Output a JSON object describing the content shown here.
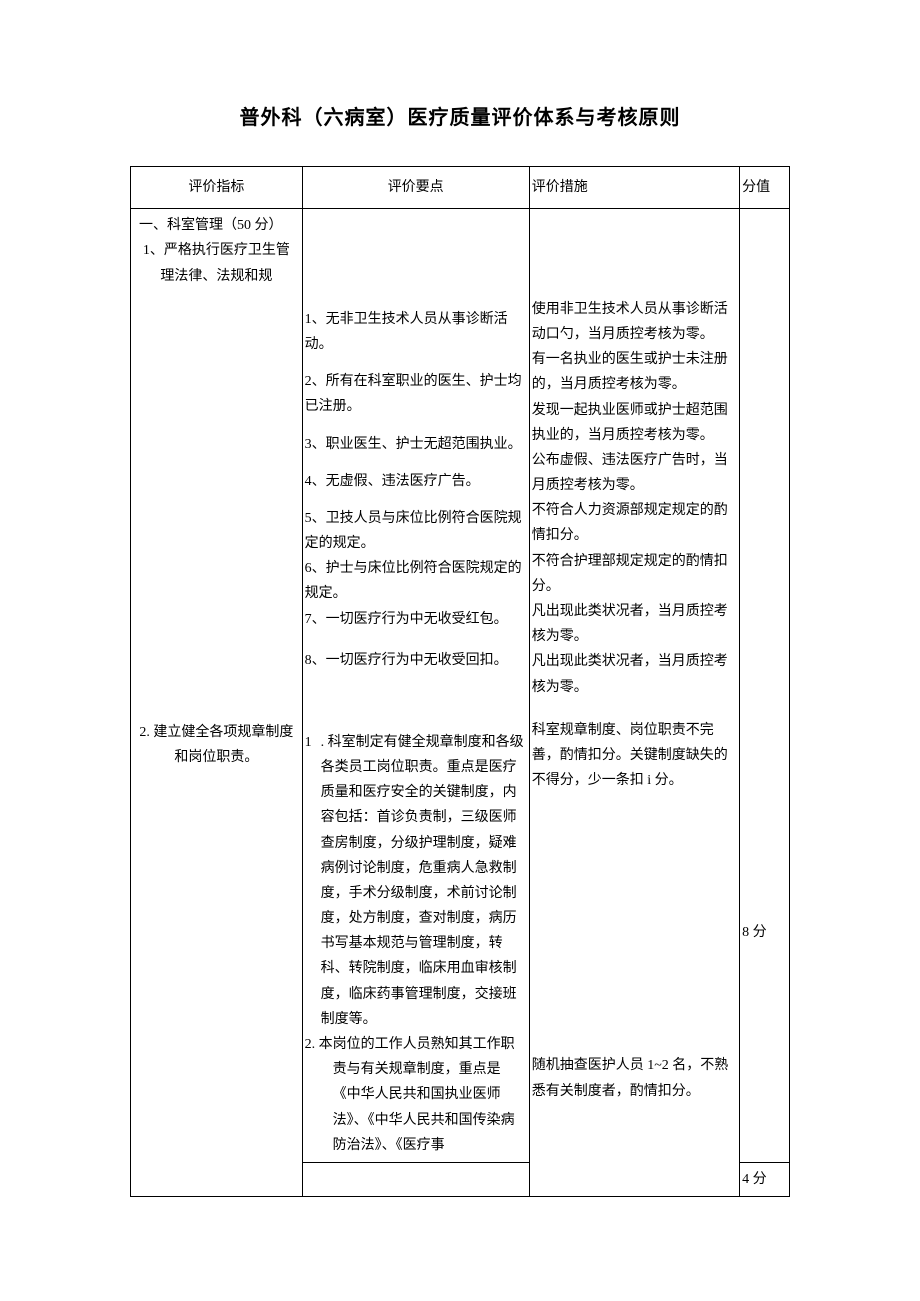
{
  "title": "普外科（六病室）医疗质量评价体系与考核原则",
  "headers": {
    "indicator": "评价指标",
    "points": "评价要点",
    "measures": "评价措施",
    "score": "分值"
  },
  "section1": {
    "heading": "一、科室管理（50 分）",
    "sub1": "1、严格执行医疗卫生管理法律、法规和规",
    "points": [
      "1、无非卫生技术人员从事诊断活动。",
      "2、所有在科室职业的医生、护士均已注册。",
      "3、职业医生、护士无超范围执业。",
      "4、无虚假、违法医疗广告。",
      "5、卫技人员与床位比例符合医院规定的规定。",
      "6、护士与床位比例符合医院规定的规定。",
      "7、一切医疗行为中无收受红包。",
      "8、一切医疗行为中无收受回扣。"
    ],
    "measures": [
      "使用非卫生技术人员从事诊断活动口勺，当月质控考核为零。",
      "有一名执业的医生或护士未注册的，当月质控考核为零。",
      "发现一起执业医师或护士超范围执业的，当月质控考核为零。",
      "公布虚假、违法医疗广告时，当月质控考核为零。",
      "不符合人力资源部规定规定的酌情扣分。",
      "不符合护理部规定规定的酌情扣分。",
      "凡出现此类状况者，当月质控考核为零。",
      "凡出现此类状况者，当月质控考核为零。"
    ]
  },
  "section2": {
    "heading": "2. 建立健全各项规章制度和岗位职责。",
    "point1_prefix": "1",
    "point1": ". 科室制定有健全规章制度和各级各类员工岗位职责。重点是医疗质量和医疗安全的关键制度，内容包括：首诊负责制，三级医师查房制度，分级护理制度，疑难病例讨论制度，危重病人急救制度，手术分级制度，术前讨论制度，处方制度，查对制度，病历书写基本规范与管理制度，转科、转院制度，临床用血审核制度，临床药事管理制度，交接班制度等。",
    "point2": "2. 本岗位的工作人员熟知其工作职责与有关规章制度，重点是《中华人民共和国执业医师法》、《中华人民共和国传染病防治法》、《医疗事",
    "measure1": "科室规章制度、岗位职责不完善，酌情扣分。关键制度缺失的不得分，少一条扣 i 分。",
    "measure2": "随机抽查医护人员 1~2 名，不熟悉有关制度者，酌情扣分。",
    "score1": "8 分",
    "score2": "4 分"
  }
}
